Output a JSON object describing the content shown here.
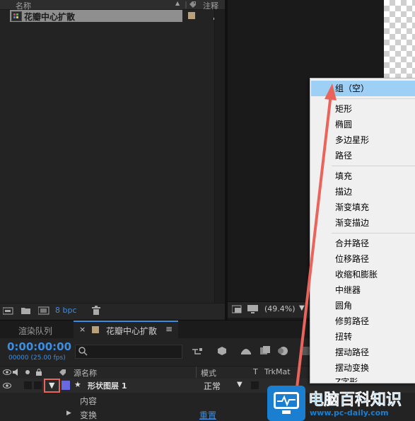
{
  "project": {
    "col_name": "名称",
    "col_comment": "注释",
    "row_name": "花瓣中心扩散",
    "bpc": "8 bpc"
  },
  "viewer": {
    "zoom": "(49.4%)"
  },
  "timeline": {
    "tab_render_queue": "渲染队列",
    "tab_comp": "花瓣中心扩散",
    "timecode": "0:00:00:00",
    "frames": "00000 (25.00 fps)",
    "search_placeholder": "",
    "col_source_name": "源名称",
    "col_mode": "模式",
    "col_t": "T",
    "col_trkmat": "TrkMat",
    "layer_name": "形状图层 1",
    "layer_mode": "正常",
    "sub_contents": "内容",
    "sub_transform": "变换",
    "reset": "重置"
  },
  "menu": {
    "items": [
      "组（空）",
      "矩形",
      "椭圆",
      "多边星形",
      "路径",
      "填充",
      "描边",
      "渐变填充",
      "渐变描边",
      "合并路径",
      "位移路径",
      "收缩和膨胀",
      "中继器",
      "圆角",
      "修剪路径",
      "扭转",
      "摆动路径",
      "摆动变换",
      "Z字形"
    ]
  },
  "watermark": {
    "title": "电脑百科知识",
    "url": "www.pc-daily.com"
  },
  "colors": {
    "menu_highlight": "#9ed0f5",
    "arrow": "#e9645a",
    "timecode": "#3a8ee6",
    "label_swatch": "#6a6ae0",
    "watermark_blue": "#1a7fd0"
  }
}
